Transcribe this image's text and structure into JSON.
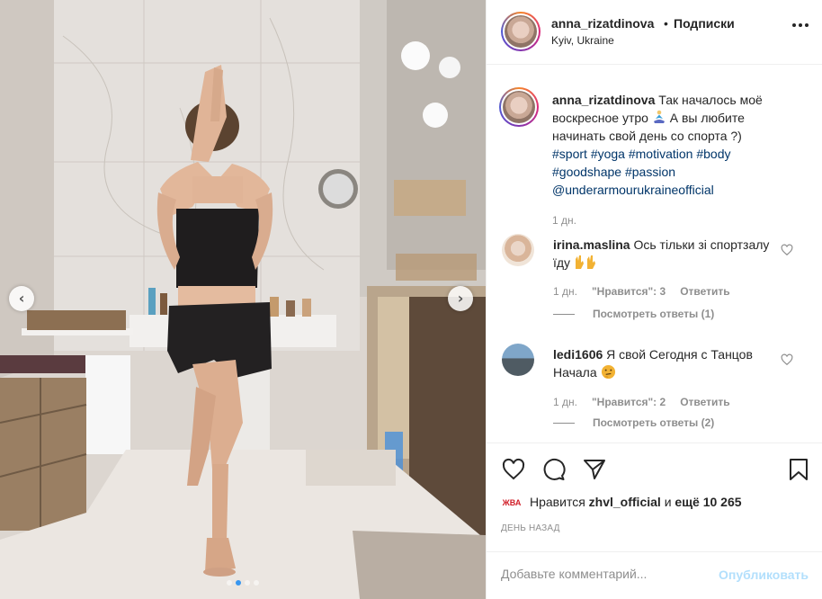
{
  "post": {
    "username": "anna_rizatdinova",
    "separator": "•",
    "follow_label": "Подписки",
    "location": "Kyiv, Ukraine",
    "more_icon": "more-horizontal-icon"
  },
  "caption": {
    "username": "anna_rizatdinova",
    "text_1": "Так началось моё воскресное утро",
    "text_2": "А вы любите начинать свой день со спорта ?)",
    "hashtags": [
      "#sport",
      "#yoga",
      "#motivation",
      "#body",
      "#goodshape",
      "#passion"
    ],
    "mention": "@underarmourukraineofficial",
    "time": "1 дн."
  },
  "comments": [
    {
      "username": "irina.maslina",
      "text": "Ось тільки зі спортзалу їду",
      "time": "1 дн.",
      "likes": "\"Нравится\": 3",
      "reply": "Ответить",
      "view_replies": "Посмотреть ответы (1)"
    },
    {
      "username": "ledi1606",
      "text": "Я свой Сегодня с Танцов Начала",
      "time": "1 дн.",
      "likes": "\"Нравится\": 2",
      "reply": "Ответить",
      "view_replies": "Посмотреть ответы (2)"
    }
  ],
  "actions": {
    "like_icon": "heart-icon",
    "comment_icon": "comment-icon",
    "share_icon": "share-icon",
    "save_icon": "bookmark-icon",
    "mini_logo_text": "ЖВА",
    "likes_prefix": "Нравится",
    "likes_user": "zhvl_official",
    "likes_mid": "и",
    "likes_count": "ещё 10 265",
    "date": "ДЕНЬ НАЗАД"
  },
  "comment_box": {
    "placeholder": "Добавьте комментарий...",
    "publish_label": "Опубликовать"
  },
  "carousel": {
    "prev_icon": "chevron-left-icon",
    "next_icon": "chevron-right-icon",
    "total": 4,
    "active_index": 1
  },
  "colors": {
    "link": "#003569",
    "muted": "#8e8e8e",
    "publish_disabled": "#b2dffc",
    "active_dot": "#3897f0"
  }
}
